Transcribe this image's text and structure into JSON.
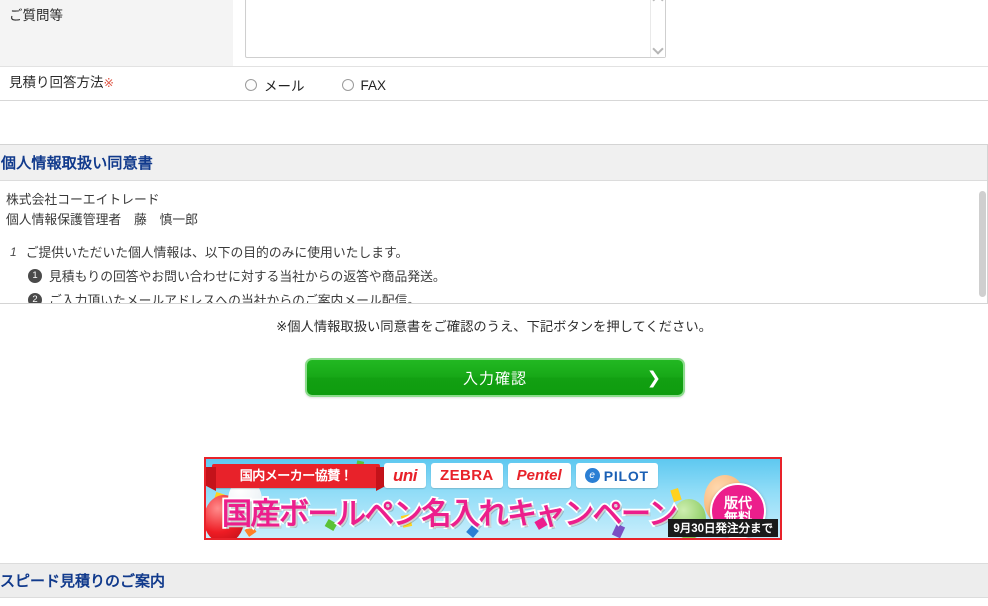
{
  "form": {
    "rows": [
      {
        "label": "ご質問等",
        "required": false,
        "control": "textarea",
        "value": "",
        "placeholder": ""
      },
      {
        "label": "見積り回答方法",
        "required": true,
        "required_mark": "※",
        "control": "radio",
        "options": [
          {
            "label": "メール",
            "checked": false
          },
          {
            "label": "FAX",
            "checked": false
          }
        ]
      }
    ]
  },
  "privacy": {
    "heading": "個人情報取扱い同意書",
    "company": "株式会社コーエイトレード",
    "manager": "個人情報保護管理者　藤　慎一郎",
    "item_number": "1",
    "item_text": "ご提供いただいた個人情報は、以下の目的のみに使用いたします。",
    "sub_items": [
      {
        "number": "❶",
        "text": "見積もりの回答やお問い合わせに対する当社からの返答や商品発送。"
      },
      {
        "number": "❷",
        "text": "ご入力頂いたメールアドレスへの当社からのご案内メール配信。"
      }
    ]
  },
  "notice": "※個人情報取扱い同意書をご確認のうえ、下記ボタンを押してください。",
  "submit": {
    "label": "入力確認",
    "arrow": "❯",
    "color": "#17a817"
  },
  "banner": {
    "ribbon": "国内メーカー協賛！",
    "logos": [
      {
        "name": "uni",
        "text": "uni"
      },
      {
        "name": "zebra",
        "text": "ZEBRA"
      },
      {
        "name": "pentel",
        "text": "Pentel"
      },
      {
        "name": "pilot",
        "text": "PILOT",
        "mark": "e"
      }
    ],
    "headline": "国産ボールペン名入れキャンペーン",
    "badge_line1": "版代",
    "badge_line2": "無料",
    "deadline": "9月30日発注分まで",
    "border_color": "#e8222a",
    "headline_color": "#ec1e8c"
  },
  "bottom_section": {
    "title": "スピード見積りのご案内"
  }
}
